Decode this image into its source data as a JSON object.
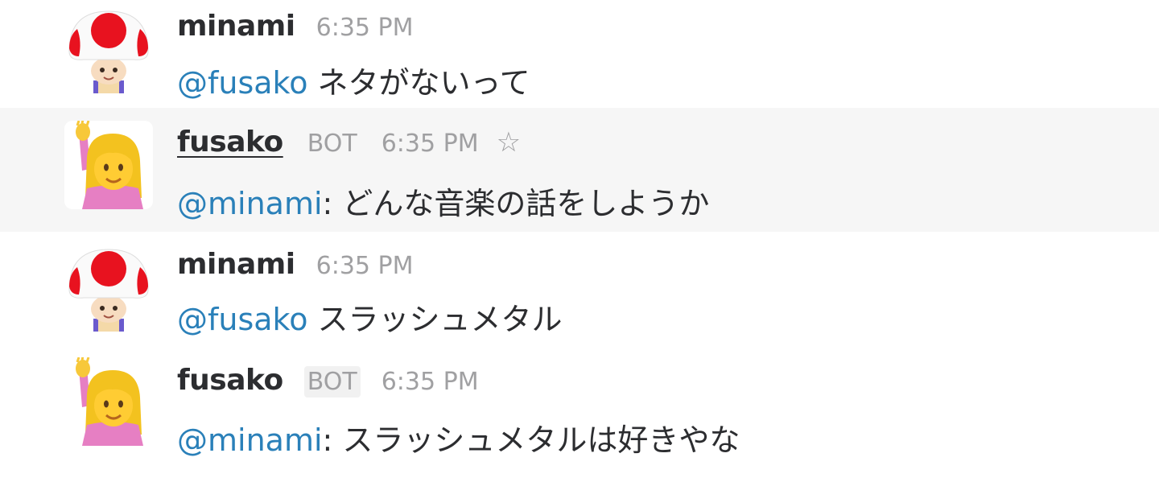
{
  "colors": {
    "mention": "#2a80b9",
    "username": "#2c2d30",
    "meta": "#a0a0a2",
    "hover_bg": "#f6f6f6"
  },
  "messages": [
    {
      "avatar_icon": "toad-mushroom-avatar-icon",
      "username": "minami",
      "bot_label": "",
      "time": "6:35 PM",
      "mention": "@fusako",
      "separator": " ",
      "text": "ネタがないって"
    },
    {
      "avatar_icon": "raising-hand-woman-avatar-icon",
      "username": "fusako",
      "bot_label": "BOT",
      "time": "6:35 PM",
      "star_icon": "star-outline-icon",
      "star_glyph": "☆",
      "mention": "@minami",
      "separator": ": ",
      "text": "どんな音楽の話をしようか"
    },
    {
      "avatar_icon": "toad-mushroom-avatar-icon",
      "username": "minami",
      "bot_label": "",
      "time": "6:35 PM",
      "mention": "@fusako",
      "separator": " ",
      "text": "スラッシュメタル"
    },
    {
      "avatar_icon": "raising-hand-woman-avatar-icon",
      "username": "fusako",
      "bot_label": "BOT",
      "time": "6:35 PM",
      "mention": "@minami",
      "separator": ": ",
      "text": "スラッシュメタルは好きやな"
    }
  ]
}
